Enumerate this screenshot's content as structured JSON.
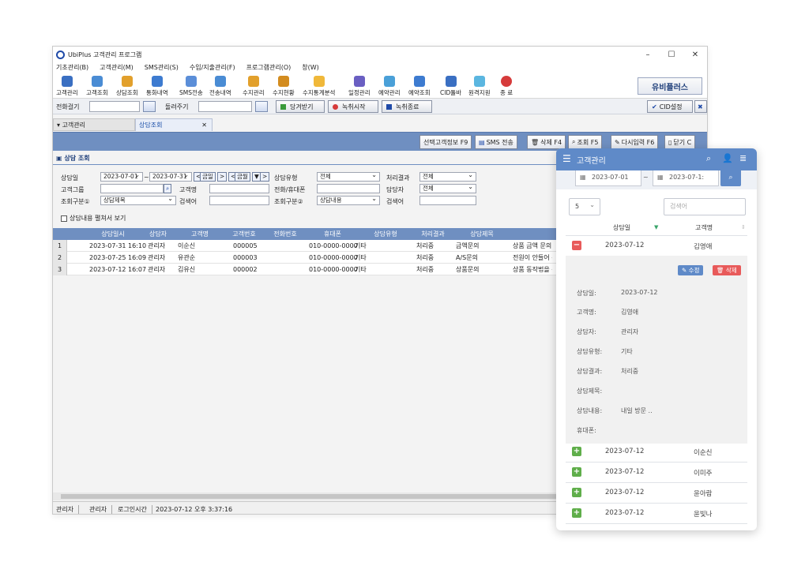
{
  "window": {
    "title": "UbiPlus 고객관리 프로그램",
    "controls": {
      "minimize": "–",
      "maximize": "☐",
      "close": "✕"
    }
  },
  "menu": [
    "기초관리(B)",
    "고객관리(M)",
    "SMS관리(S)",
    "수입/지출관리(F)",
    "프로그램관리(O)",
    "창(W)"
  ],
  "toolbar": {
    "buttons": [
      {
        "label": "고객관리",
        "color": "#3a6fc2"
      },
      {
        "label": "고객조회",
        "color": "#4a8cd4"
      },
      {
        "label": "상담조회",
        "color": "#e2a02c"
      },
      {
        "label": "통화내역",
        "color": "#3d7bd0"
      },
      {
        "label": "SMS전송",
        "color": "#5b8ed8"
      },
      {
        "label": "전송내역",
        "color": "#4a8cd4"
      },
      {
        "label": "수지관리",
        "color": "#e2a02c"
      },
      {
        "label": "수지현황",
        "color": "#d38c1f"
      },
      {
        "label": "수지통계분석",
        "color": "#f0b83a"
      },
      {
        "label": "일정관리",
        "color": "#6a5fc2"
      },
      {
        "label": "예약관리",
        "color": "#4aa0d8"
      },
      {
        "label": "예약조회",
        "color": "#3d7bd0"
      },
      {
        "label": "CID툴바",
        "color": "#3a6fc2"
      },
      {
        "label": "원격지원",
        "color": "#5bb6e0"
      },
      {
        "label": "종 료",
        "color": "#d63b3b"
      }
    ],
    "brand": "유비플러스"
  },
  "callbar": {
    "dial_label": "전화걸기",
    "sms_label": "돌려주기",
    "receive": "당겨받기",
    "record_start": "녹취시작",
    "record_stop": "녹취종료",
    "cid_settings": "CID설정",
    "close_glyph": "✖"
  },
  "tabs": {
    "customer": "고객관리",
    "consult": "상담조회",
    "close_glyph": "✕"
  },
  "actions": {
    "selected_info": "선택고객정보 F9",
    "sms": "SMS 전송",
    "delete": "삭제 F4",
    "search": "조회 F5",
    "reinput": "다시입력 F6",
    "close": "닫기 C"
  },
  "section_title": "상담 조회",
  "filters": {
    "date_label": "상담일",
    "date_from": "2023-07-01",
    "date_sep": "~",
    "date_to": "2023-07-31",
    "today": "금일",
    "this_month": "금월",
    "prev": "<",
    "next": ">",
    "drop": "▼",
    "group_label": "고객그룹",
    "type_label": "상담유형",
    "type_value": "전체",
    "result_label": "처리결과",
    "result_value": "전체",
    "name_label": "고객명",
    "phone_label": "전화/휴대폰",
    "staff_label": "담당자",
    "staff_value": "전체",
    "cond1_label": "조회구분①",
    "cond1_value": "상담제목",
    "keyword1_label": "검색어",
    "cond2_label": "조회구분②",
    "cond2_value": "상담내용",
    "keyword2_label": "검색어",
    "expand_label": "상담내용 펼쳐서 보기"
  },
  "grid": {
    "columns": [
      "상담일시",
      "상담자",
      "고객명",
      "고객번호",
      "전화번호",
      "휴대폰",
      "상담유형",
      "처리결과",
      "상담제목"
    ],
    "rows": [
      {
        "no": "1",
        "datetime": "2023-07-31 16:10",
        "staff": "관리자",
        "name": "이순신",
        "cust_no": "000005",
        "phone": "",
        "mobile": "010-0000-0000",
        "type": "기타",
        "result": "처리중",
        "title": "금액문의",
        "content": "상품 금액 문의 !"
      },
      {
        "no": "2",
        "datetime": "2023-07-25 16:09",
        "staff": "관리자",
        "name": "유관순",
        "cust_no": "000003",
        "phone": "",
        "mobile": "010-0000-0000",
        "type": "기타",
        "result": "처리중",
        "title": "A/S문의",
        "content": "전원이 안들어 옴"
      },
      {
        "no": "3",
        "datetime": "2023-07-12 16:07",
        "staff": "관리자",
        "name": "김유신",
        "cust_no": "000002",
        "phone": "",
        "mobile": "010-0000-0000",
        "type": "기타",
        "result": "처리중",
        "title": "상품문의",
        "content": "상품 동작법을 문"
      }
    ]
  },
  "statusbar": {
    "user1": "관리자",
    "user2": "관리자",
    "login_label": "로그인시간",
    "login_time": "2023-07-12 오후 3:37:16"
  },
  "mobile": {
    "title": "고객관리",
    "date_from": "2023-07-01",
    "date_to": "2023-07-1:",
    "date_sep": "~",
    "page_size": "5",
    "search_placeholder": "검색어",
    "col_date": "상담일",
    "col_name": "고객명",
    "expanded": {
      "date": "2023-07-12",
      "name": "김영애",
      "edit": "✎ 수정",
      "delete": "🗑 삭제",
      "details": [
        {
          "label": "상담일:",
          "value": "2023-07-12"
        },
        {
          "label": "고객명:",
          "value": "김영애"
        },
        {
          "label": "상담자:",
          "value": "관리자"
        },
        {
          "label": "상담유형:",
          "value": "기타"
        },
        {
          "label": "상담결과:",
          "value": "처리중"
        },
        {
          "label": "상담제목:",
          "value": ""
        },
        {
          "label": "상담내용:",
          "value": "내일 방문 .."
        },
        {
          "label": "휴대폰:",
          "value": ""
        }
      ]
    },
    "rows": [
      {
        "date": "2023-07-12",
        "name": "이순신"
      },
      {
        "date": "2023-07-12",
        "name": "이미주"
      },
      {
        "date": "2023-07-12",
        "name": "윤아람"
      },
      {
        "date": "2023-07-12",
        "name": "윤빛나"
      }
    ]
  }
}
